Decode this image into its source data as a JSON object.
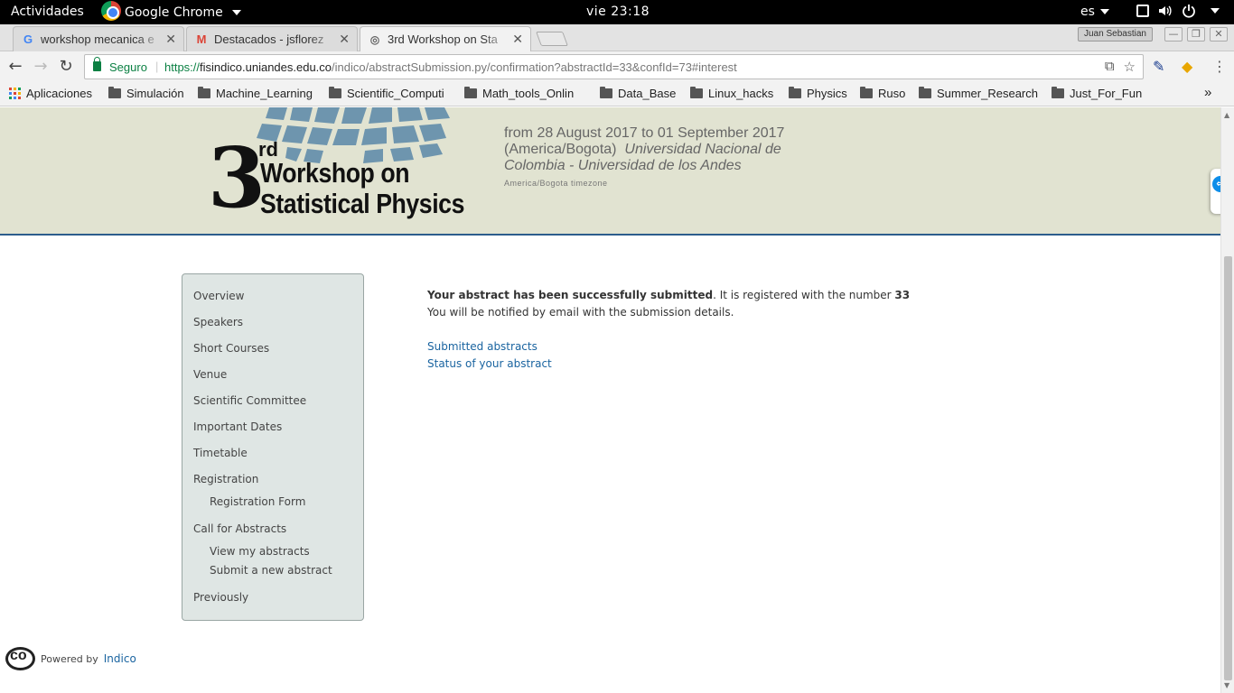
{
  "system_bar": {
    "activities": "Actividades",
    "app_name": "Google Chrome",
    "clock": "vie 23:18",
    "language": "es"
  },
  "tabs": [
    {
      "title": "workshop mecanica e",
      "favicon": "google-g-icon",
      "active": false
    },
    {
      "title": "Destacados - jsflorez",
      "favicon": "gmail-icon",
      "active": false
    },
    {
      "title": "3rd Workshop on Sta",
      "favicon": "indico-icon",
      "active": true
    }
  ],
  "window": {
    "user_badge": "Juan Sebastian"
  },
  "omnibox": {
    "secure_label": "Seguro",
    "url_scheme": "https://",
    "url_host": "fisindico.uniandes.edu.co",
    "url_path": "/indico/abstractSubmission.py/confirmation?abstractId=33&confId=73#interest"
  },
  "bookmarks": [
    "Aplicaciones",
    "Simulación",
    "Machine_Learning",
    "Scientific_Computi",
    "Math_tools_Onlin",
    "Data_Base",
    "Linux_hacks",
    "Physics",
    "Ruso",
    "Summer_Research",
    "Just_For_Fun"
  ],
  "banner": {
    "logo_number": "3",
    "logo_suffix": "rd",
    "logo_line1": "Workshop on",
    "logo_line2": "Statistical Physics",
    "dates": "from 28 August 2017 to 01 September 2017",
    "timezone_label": "(America/Bogota)",
    "place_line1": "Universidad Nacional de",
    "place_line2": "Colombia - Universidad de los Andes",
    "tz_note": "America/Bogota timezone"
  },
  "menu": {
    "items": [
      {
        "label": "Overview",
        "sub": false
      },
      {
        "label": "Speakers",
        "sub": false
      },
      {
        "label": "Short Courses",
        "sub": false
      },
      {
        "label": "Venue",
        "sub": false
      },
      {
        "label": "Scientific Committee",
        "sub": false
      },
      {
        "label": "Important Dates",
        "sub": false
      },
      {
        "label": "Timetable",
        "sub": false
      },
      {
        "label": "Registration",
        "sub": false
      },
      {
        "label": "Registration Form",
        "sub": true
      },
      {
        "label": "Call for Abstracts",
        "sub": false
      },
      {
        "label": "View my abstracts",
        "sub": true
      },
      {
        "label": "Submit a new abstract",
        "sub": true
      },
      {
        "label": "Previously",
        "sub": false
      }
    ]
  },
  "confirmation": {
    "bold_text": "Your abstract has been successfully submitted",
    "registered_text": ". It is registered with the number ",
    "abstract_number": "33",
    "notify_text": "You will be notified by email with the submission details.",
    "link_submitted": "Submitted abstracts",
    "link_status": "Status of your abstract"
  },
  "footer": {
    "powered_by": "Powered by",
    "indico": "Indico"
  }
}
